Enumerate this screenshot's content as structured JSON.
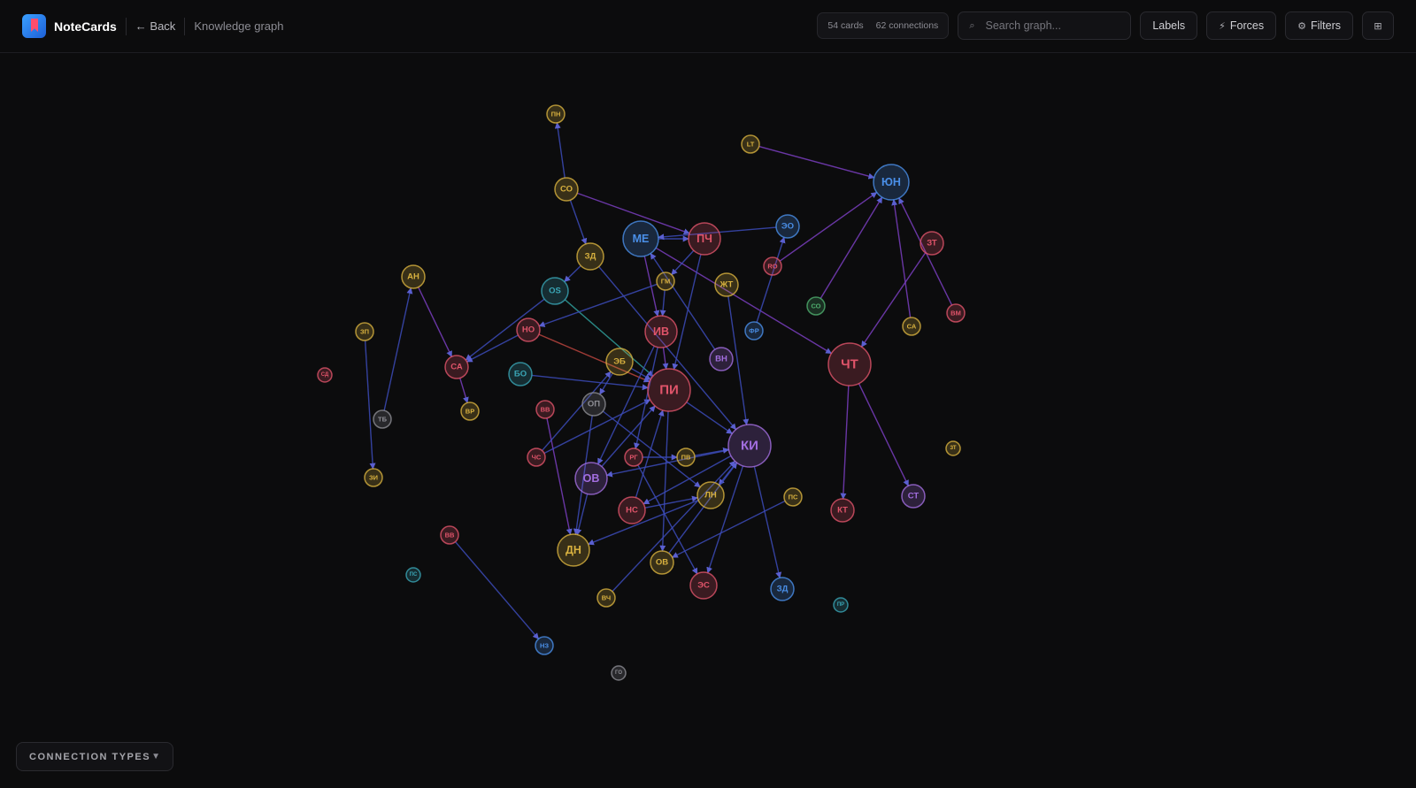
{
  "app": {
    "name": "NoteCards",
    "back_label": "← Back",
    "breadcrumb": "Knowledge graph"
  },
  "toolbar": {
    "cards": "54 cards",
    "connections": "62 connections",
    "search_placeholder": "Search graph...",
    "labels_button": "Labels",
    "forces_button": "Forces",
    "filters_button": "Filters",
    "forces_icon": "bolt-icon",
    "filters_icon": "filter-icon",
    "layout_icon": "grid-icon"
  },
  "legend": {
    "label": "CONNECTION TYPES"
  },
  "colors": {
    "yellow": "#d8b13f",
    "red": "#e0546a",
    "blue": "#4a8fe8",
    "purple": "#a36ee0",
    "teal": "#3aa6b6",
    "green": "#4fae6e",
    "gray": "#8d8d94",
    "edge_blue": "#3c4bb8",
    "edge_purple": "#7a3ec0",
    "edge_red": "#b8443e",
    "edge_teal": "#2f9e9a"
  },
  "graph": {
    "nodes": [
      {
        "id": "pn",
        "label": "ПН",
        "color": "yellow"
      },
      {
        "id": "lt",
        "label": "LT",
        "color": "yellow"
      },
      {
        "id": "yun",
        "label": "ЮН",
        "color": "blue"
      },
      {
        "id": "so1",
        "label": "СО",
        "color": "yellow"
      },
      {
        "id": "me",
        "label": "МЕ",
        "color": "blue"
      },
      {
        "id": "pch",
        "label": "ПЧ",
        "color": "red"
      },
      {
        "id": "eo",
        "label": "ЭО",
        "color": "blue"
      },
      {
        "id": "zt",
        "label": "ЗТ",
        "color": "red"
      },
      {
        "id": "zd1",
        "label": "ЗД",
        "color": "yellow"
      },
      {
        "id": "ro",
        "label": "RO",
        "color": "red"
      },
      {
        "id": "an",
        "label": "АН",
        "color": "yellow"
      },
      {
        "id": "os",
        "label": "OS",
        "color": "teal"
      },
      {
        "id": "gm",
        "label": "ГМ",
        "color": "yellow"
      },
      {
        "id": "zht",
        "label": "ЖТ",
        "color": "yellow"
      },
      {
        "id": "so2",
        "label": "СО",
        "color": "green"
      },
      {
        "id": "vm",
        "label": "ВМ",
        "color": "red"
      },
      {
        "id": "zp",
        "label": "ЗП",
        "color": "yellow"
      },
      {
        "id": "no",
        "label": "НО",
        "color": "red"
      },
      {
        "id": "iv",
        "label": "ИВ",
        "color": "red"
      },
      {
        "id": "fr",
        "label": "ФР",
        "color": "blue"
      },
      {
        "id": "sa1",
        "label": "СА",
        "color": "yellow"
      },
      {
        "id": "sd",
        "label": "СД",
        "color": "red"
      },
      {
        "id": "sa2",
        "label": "СА",
        "color": "red"
      },
      {
        "id": "bo",
        "label": "БО",
        "color": "teal"
      },
      {
        "id": "eb",
        "label": "ЭБ",
        "color": "yellow"
      },
      {
        "id": "vn",
        "label": "ВН",
        "color": "purple"
      },
      {
        "id": "cht",
        "label": "ЧТ",
        "color": "red"
      },
      {
        "id": "pi",
        "label": "ПИ",
        "color": "red"
      },
      {
        "id": "tb",
        "label": "ТБ",
        "color": "gray"
      },
      {
        "id": "vr",
        "label": "ВР",
        "color": "yellow"
      },
      {
        "id": "vv1",
        "label": "ВВ",
        "color": "red"
      },
      {
        "id": "op",
        "label": "ОП",
        "color": "gray"
      },
      {
        "id": "ki",
        "label": "КИ",
        "color": "purple"
      },
      {
        "id": "zt2",
        "label": "ЗТ",
        "color": "yellow"
      },
      {
        "id": "chs",
        "label": "ЧС",
        "color": "red"
      },
      {
        "id": "rg",
        "label": "РГ",
        "color": "red"
      },
      {
        "id": "pv",
        "label": "ПВ",
        "color": "yellow"
      },
      {
        "id": "ov1",
        "label": "ОВ",
        "color": "purple"
      },
      {
        "id": "zi",
        "label": "ЗИ",
        "color": "yellow"
      },
      {
        "id": "ln",
        "label": "ЛН",
        "color": "yellow"
      },
      {
        "id": "ps1",
        "label": "ПС",
        "color": "yellow"
      },
      {
        "id": "st",
        "label": "СТ",
        "color": "purple"
      },
      {
        "id": "ns",
        "label": "НС",
        "color": "red"
      },
      {
        "id": "kt",
        "label": "КТ",
        "color": "red"
      },
      {
        "id": "vv2",
        "label": "ВВ",
        "color": "red"
      },
      {
        "id": "dn",
        "label": "ДН",
        "color": "yellow"
      },
      {
        "id": "ov2",
        "label": "ОВ",
        "color": "yellow"
      },
      {
        "id": "ps2",
        "label": "ПС",
        "color": "teal"
      },
      {
        "id": "es",
        "label": "ЭС",
        "color": "red"
      },
      {
        "id": "zd2",
        "label": "ЗД",
        "color": "blue"
      },
      {
        "id": "pr",
        "label": "ПР",
        "color": "teal"
      },
      {
        "id": "vch",
        "label": "ВЧ",
        "color": "yellow"
      },
      {
        "id": "nz",
        "label": "НЗ",
        "color": "blue"
      },
      {
        "id": "go",
        "label": "ГО",
        "color": "gray"
      }
    ]
  }
}
